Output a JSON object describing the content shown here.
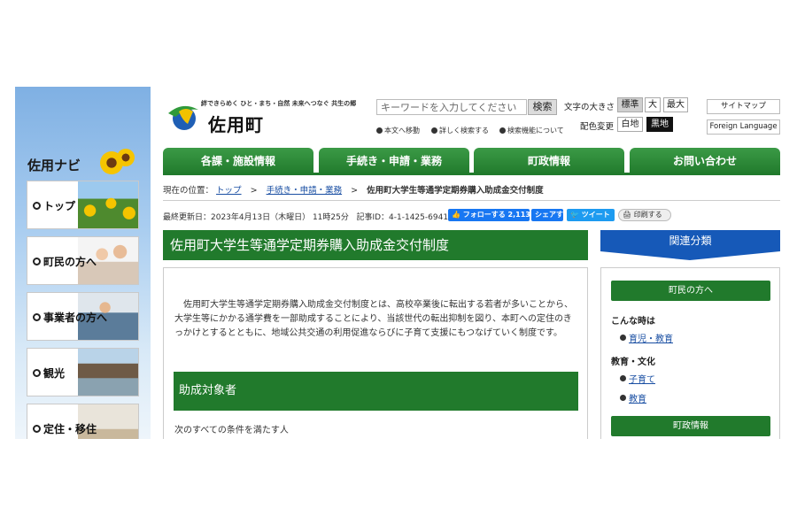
{
  "sidebar": {
    "title": "佐用ナビ",
    "items": [
      {
        "label": "トップ"
      },
      {
        "label": "町民の方へ"
      },
      {
        "label": "事業者の方へ"
      },
      {
        "label": "観光"
      },
      {
        "label": "定住・移住"
      }
    ]
  },
  "header": {
    "tagline": "絆できらめく ひと・まち・自然 未来へつなぐ 共生の郷",
    "logo_name": "佐用町",
    "search": {
      "placeholder": "キーワードを入力してください",
      "button": "検索"
    },
    "sub_links": [
      "本文へ移動",
      "詳しく検索する",
      "検索機能について"
    ],
    "font_size": {
      "label": "文字の大きさ",
      "options": [
        "標準",
        "大",
        "最大"
      ],
      "selected": "標準"
    },
    "color_scheme": {
      "label": "配色変更",
      "options": [
        "白地",
        "黒地"
      ]
    },
    "sitemap": "サイトマップ",
    "foreign": "Foreign Language"
  },
  "global_nav": [
    "各課・施設情報",
    "手続き・申請・業務",
    "町政情報",
    "お問い合わせ"
  ],
  "breadcrumb": {
    "prefix": "現在の位置：",
    "items": [
      "トップ",
      "手続き・申請・業務"
    ],
    "current": "佐用町大学生等通学定期券購入助成金交付制度"
  },
  "meta": {
    "updated": "最終更新日：2023年4月13日（木曜日） 11時25分",
    "article_id": "記事ID：4-1-1425-6941",
    "fb_follow": "フォローする 2,113",
    "fb_share": "シェアする",
    "tweet": "ツイート",
    "print": "印刷する"
  },
  "article": {
    "title": "佐用町大学生等通学定期券購入助成金交付制度",
    "intro": "佐用町大学生等通学定期券購入助成金交付制度とは、高校卒業後に転出する若者が多いことから、大学生等にかかる通学費を一部助成することにより、当該世代の転出抑制を図り、本町への定住のきっかけとするとともに、地域公共交通の利用促進ならびに子育て支援にもつなげていく制度です。",
    "section_heading": "助成対象者",
    "conditions": "次のすべての条件を満たす人"
  },
  "related": {
    "heading": "関連分類",
    "cat1": "町民の方へ",
    "group1": {
      "heading": "こんな時は",
      "links": [
        "育児・教育"
      ]
    },
    "group2": {
      "heading": "教育・文化",
      "links": [
        "子育て",
        "教育"
      ]
    },
    "cat2": "町政情報"
  },
  "colors": {
    "green": "#217a2c",
    "blue": "#1659b8",
    "link": "#1a4fa3"
  }
}
